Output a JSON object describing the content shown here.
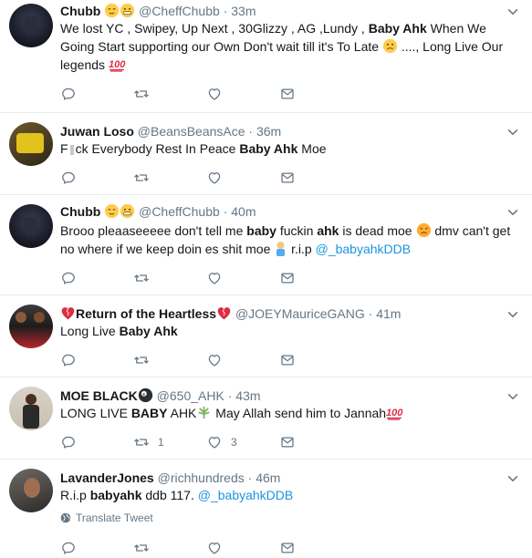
{
  "tweets": [
    {
      "name": "Chubb",
      "handle": "@CheffChubb",
      "time": "33m",
      "text_parts": [
        "We lost YC , Swipey, Up Next , 30Glizzy , AG ,Lundy , ",
        "Baby Ahk",
        " When We Going Start supporting our Own Don't wait till it's To Late ",
        " ...., Long Live Our legends "
      ],
      "replies": "",
      "retweets": "",
      "likes": ""
    },
    {
      "name": "Juwan Loso",
      "handle": "@BeansBeansAce",
      "time": "36m",
      "text_parts": [
        "F",
        "ck Everybody Rest In Peace ",
        "Baby Ahk",
        " Moe"
      ],
      "replies": "",
      "retweets": "",
      "likes": ""
    },
    {
      "name": "Chubb",
      "handle": "@CheffChubb",
      "time": "40m",
      "text_parts": [
        "Brooo pleaaseeeee don't tell me ",
        "baby",
        " fuckin ",
        "ahk",
        " is dead moe ",
        " dmv can't get no where if we keep doin es shit moe ",
        " r.i.p ",
        "@_babyahkDDB"
      ],
      "replies": "",
      "retweets": "",
      "likes": ""
    },
    {
      "name": "Return of the Heartless",
      "handle": "@JOEYMauriceGANG",
      "time": "41m",
      "text_parts": [
        "Long Live ",
        "Baby Ahk"
      ],
      "replies": "",
      "retweets": "",
      "likes": ""
    },
    {
      "name": "MOE BLACK",
      "handle": "@650_AHK",
      "time": "43m",
      "text_parts": [
        "LONG LIVE ",
        "BABY",
        " AHK",
        " May Allah send him to Jannah"
      ],
      "replies": "",
      "retweets": "1",
      "likes": "3"
    },
    {
      "name": "LavanderJones",
      "handle": "@richhundreds",
      "time": "46m",
      "text_parts": [
        "R.i.p ",
        "babyahk",
        " ddb 117. ",
        "@_babyahkDDB"
      ],
      "translate": "Translate Tweet",
      "replies": "",
      "retweets": "",
      "likes": ""
    }
  ],
  "colors": {
    "text": "#14171a",
    "muted": "#657786",
    "link": "#1b95e0",
    "border": "#e6ecf0"
  },
  "icons": [
    "reply-icon",
    "retweet-icon",
    "like-icon",
    "message-icon",
    "chevron-down-icon",
    "globe-icon"
  ]
}
